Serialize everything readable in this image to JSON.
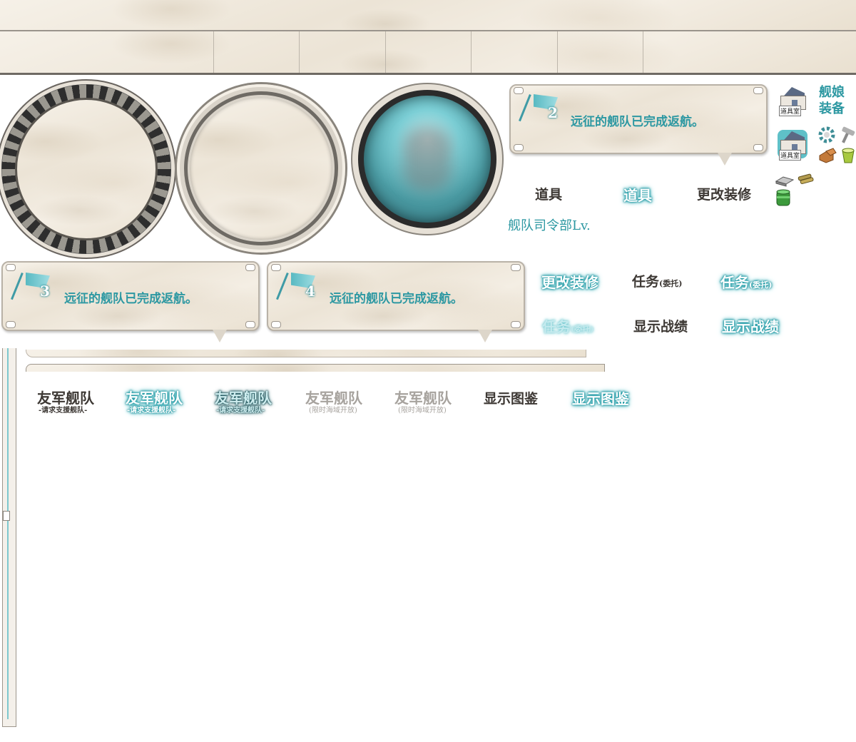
{
  "expedition": {
    "fleet2": {
      "number": "2",
      "message": "远征的舰队已完成返航。"
    },
    "fleet3": {
      "number": "3",
      "message": "远征的舰队已完成返航。"
    },
    "fleet4": {
      "number": "4",
      "message": "远征的舰队已完成返航。"
    }
  },
  "sidebar": {
    "shipgirl_equipment_line1": "舰娘",
    "shipgirl_equipment_line2": "装备",
    "item_shop_tag": "道具室",
    "item_shop_tag_active": "道具室"
  },
  "labels": {
    "items": "道具",
    "items_glow": "道具",
    "remodel": "更改装修",
    "remodel_glow": "更改装修",
    "hq_level": "舰队司令部Lv.",
    "quest": "任务",
    "quest_sub": "(委托)",
    "quest_glow": "任务",
    "quest_glow_sub": "(委托)",
    "quest_faded": "任务",
    "quest_faded_sub": "(委托)",
    "record": "显示战绩",
    "record_glow": "显示战绩",
    "friend_fleet": "友军舰队",
    "friend_fleet_sub": "-请求支援舰队-",
    "friend_fleet_glow": "友军舰队",
    "friend_fleet_glow_sub": "-请求支援舰队-",
    "friend_fleet_dark": "友军舰队",
    "friend_fleet_dark_sub": "-请求支援舰队-",
    "friend_fleet_locked1": "友军舰队",
    "friend_fleet_locked1_sub": "(限时海域开放)",
    "friend_fleet_locked2": "友军舰队",
    "friend_fleet_locked2_sub": "(限时海域开放)",
    "encyclopedia": "显示图鉴",
    "encyclopedia_glow": "显示图鉴"
  },
  "icons": {
    "hq_banner": "marble-banner",
    "gear_dial": "gear-dial-icon",
    "ring_dial": "ring-dial-icon",
    "glass_dial": "glass-dial-icon",
    "flag": "flag-icon",
    "item_shop": "item-shop-icon",
    "wrench": "wrench-icon",
    "hammer": "hammer-icon",
    "bauxite": "bauxite-icon",
    "bucket": "bucket-icon",
    "steel": "steel-icon",
    "ammo": "ammo-icon",
    "fuel": "fuel-icon"
  },
  "colors": {
    "teal": "#2d98a2",
    "glow": "#1f9aa5",
    "text_dark": "#3d3834",
    "marble": "#f1ebe0"
  }
}
